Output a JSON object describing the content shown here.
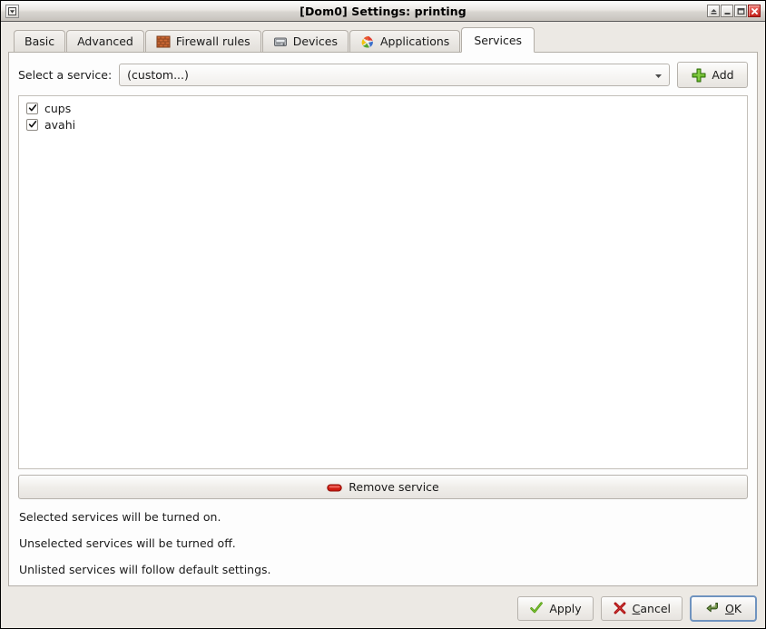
{
  "window": {
    "title": "[Dom0] Settings: printing",
    "menu_icon": "window-menu-icon",
    "controls": [
      {
        "name": "shade-button",
        "icon": "shade-icon"
      },
      {
        "name": "minimize-button",
        "icon": "minimize-icon"
      },
      {
        "name": "maximize-button",
        "icon": "maximize-icon"
      },
      {
        "name": "close-button",
        "icon": "close-icon"
      }
    ]
  },
  "tabs": [
    {
      "label": "Basic",
      "icon": null,
      "active": false
    },
    {
      "label": "Advanced",
      "icon": null,
      "active": false
    },
    {
      "label": "Firewall rules",
      "icon": "brick-wall-icon",
      "active": false
    },
    {
      "label": "Devices",
      "icon": "device-icon",
      "active": false
    },
    {
      "label": "Applications",
      "icon": "applications-icon",
      "active": false
    },
    {
      "label": "Services",
      "icon": null,
      "active": true
    }
  ],
  "services_tab": {
    "select_label": "Select a service:",
    "combo": {
      "value": "(custom...)",
      "placeholder": "(custom...)",
      "arrow_icon": "chevron-down-icon"
    },
    "add_button": {
      "label": "Add",
      "icon": "plus-icon"
    },
    "list": [
      {
        "label": "cups",
        "checked": true
      },
      {
        "label": "avahi",
        "checked": true
      }
    ],
    "remove_button": {
      "label": "Remove service",
      "icon": "minus-icon"
    },
    "hints": [
      "Selected services will be turned on.",
      "Unselected services will be turned off.",
      "Unlisted services will follow default settings."
    ]
  },
  "footer": {
    "buttons": [
      {
        "name": "apply-button",
        "label": "Apply",
        "icon": "check-icon",
        "accel": "",
        "default": false
      },
      {
        "name": "cancel-button",
        "label": "Cancel",
        "icon": "x-icon",
        "accel": "C",
        "default": false
      },
      {
        "name": "ok-button",
        "label": "OK",
        "icon": "enter-arrow-icon",
        "accel": "O",
        "default": true
      }
    ]
  },
  "colors": {
    "accent_green": "#4e9a06",
    "accent_red": "#cc0000",
    "focus_blue": "#6f93bf",
    "panel_bg": "#fdfdfd",
    "window_bg": "#ece9e4"
  }
}
